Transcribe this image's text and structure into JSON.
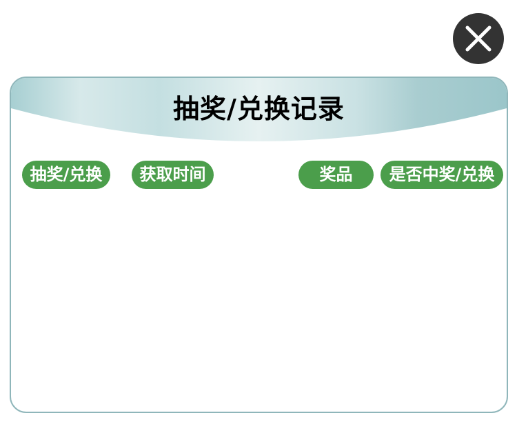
{
  "dialog": {
    "title": "抽奖/兑换记录",
    "close_icon": "close-icon",
    "columns": [
      {
        "label": "抽奖/兑换"
      },
      {
        "label": "获取时间"
      },
      {
        "label": "奖品"
      },
      {
        "label": "是否中奖/兑换"
      }
    ],
    "records": []
  },
  "colors": {
    "accent_green": "#4b9e4b",
    "panel_border": "#8fb6ba",
    "header_teal": "#9ec9cd",
    "close_bg": "#333333"
  }
}
